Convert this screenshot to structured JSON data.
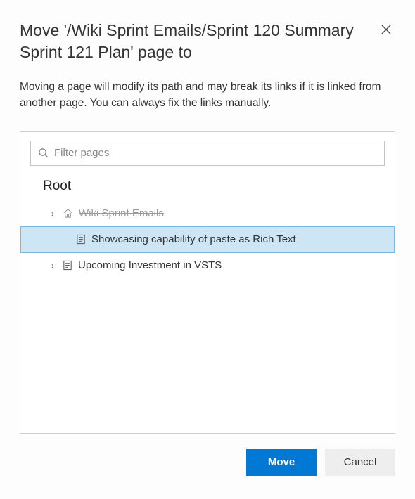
{
  "dialog": {
    "title": "Move '/Wiki Sprint Emails/Sprint 120 Summary Sprint 121 Plan' page to",
    "description": "Moving a page will modify its path and may break its links if it is linked from another page. You can always fix the links manually."
  },
  "filter": {
    "placeholder": "Filter pages",
    "value": ""
  },
  "tree": {
    "root_label": "Root",
    "items": [
      {
        "label": "Wiki Sprint Emails",
        "icon": "home-icon",
        "expandable": true,
        "disabled": true,
        "selected": false,
        "level": 1
      },
      {
        "label": "Showcasing capability of paste as Rich Text",
        "icon": "page-icon",
        "expandable": false,
        "disabled": false,
        "selected": true,
        "level": 2
      },
      {
        "label": "Upcoming Investment in VSTS",
        "icon": "page-icon",
        "expandable": true,
        "disabled": false,
        "selected": false,
        "level": 1
      }
    ]
  },
  "buttons": {
    "move": "Move",
    "cancel": "Cancel"
  },
  "glyphs": {
    "chevron": "›"
  }
}
